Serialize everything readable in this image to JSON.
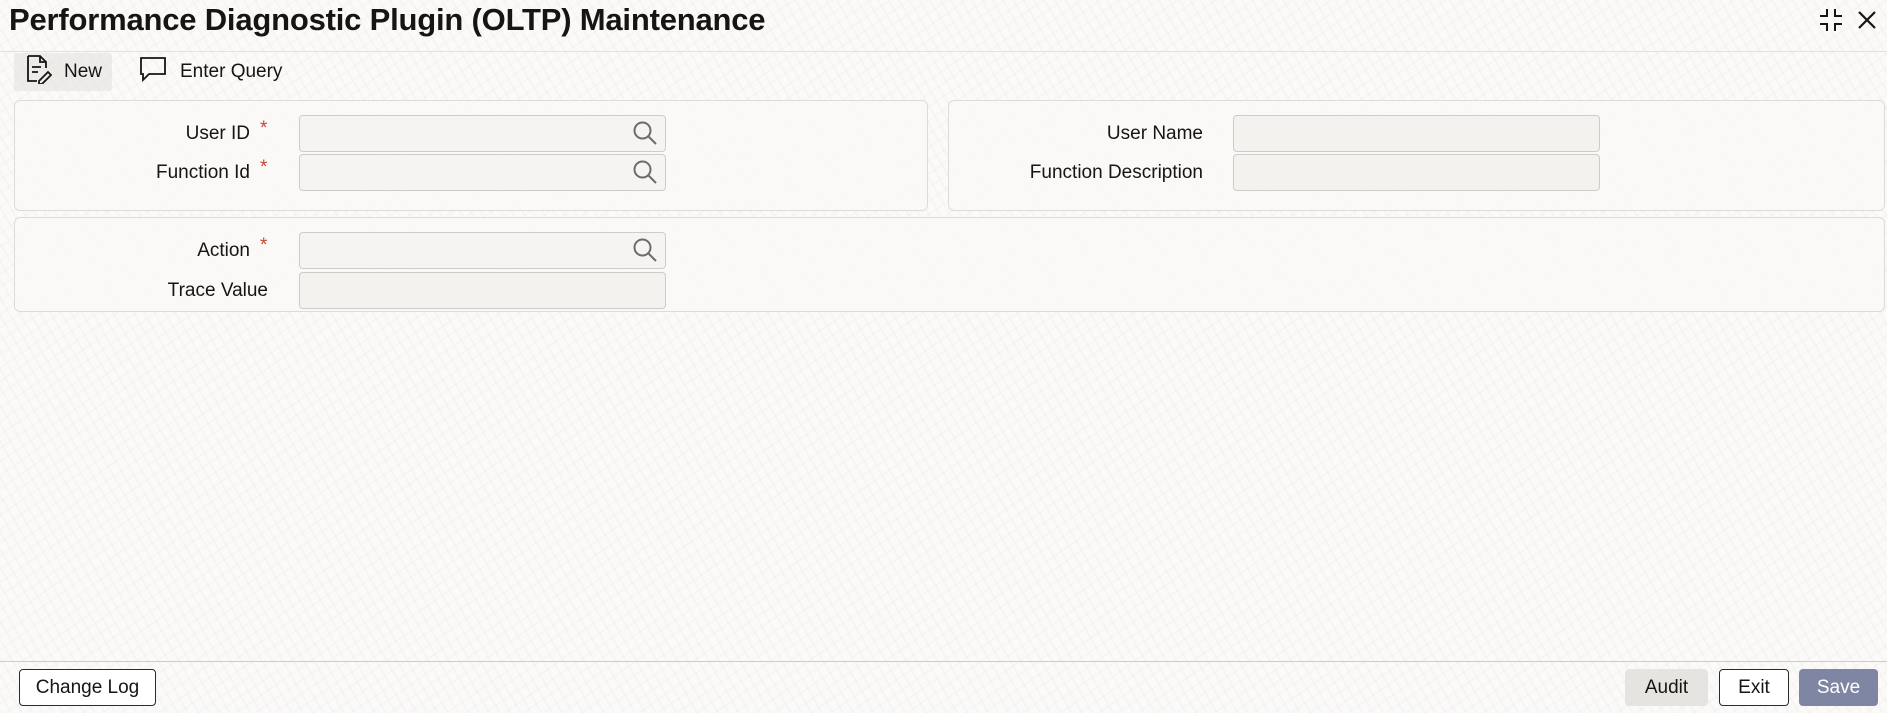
{
  "window": {
    "title": "Performance Diagnostic Plugin (OLTP) Maintenance",
    "controls": {
      "minimize_icon": "collapse-icon",
      "close_icon": "close-icon"
    }
  },
  "toolbar": {
    "new_label": "New",
    "new_icon": "new-document-icon",
    "query_label": "Enter Query",
    "query_icon": "speech-bubble-icon"
  },
  "form": {
    "user_id": {
      "label": "User ID",
      "required": "*",
      "value": "",
      "icon": "search-icon"
    },
    "function_id": {
      "label": "Function Id",
      "required": "*",
      "value": "",
      "icon": "search-icon"
    },
    "user_name": {
      "label": "User Name",
      "value": ""
    },
    "function_description": {
      "label": "Function Description",
      "value": ""
    },
    "action": {
      "label": "Action",
      "required": "*",
      "value": "",
      "icon": "search-icon"
    },
    "trace_value": {
      "label": "Trace Value",
      "value": ""
    }
  },
  "footer": {
    "change_log_label": "Change Log",
    "audit_label": "Audit",
    "exit_label": "Exit",
    "save_label": "Save"
  },
  "colors": {
    "required": "#c74634",
    "save_button": "#7f86a3",
    "text": "#161513"
  }
}
